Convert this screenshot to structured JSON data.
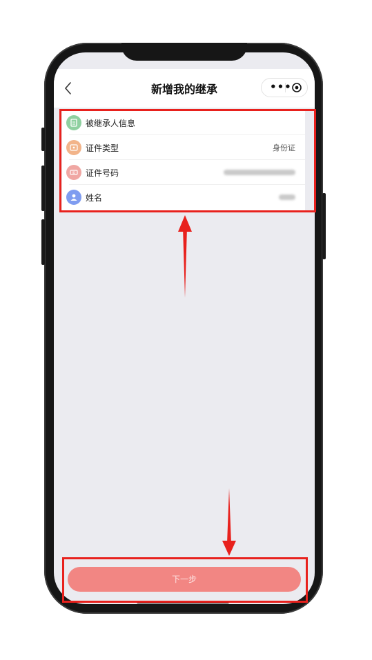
{
  "navbar": {
    "title": "新增我的继承",
    "more_glyph": "•••"
  },
  "form": {
    "rows": [
      {
        "label": "被继承人信息",
        "value": "",
        "icon": "document-icon",
        "icon_color": "#8fd0a0"
      },
      {
        "label": "证件类型",
        "value": "身份证",
        "icon": "card-icon",
        "icon_color": "#f2b48a"
      },
      {
        "label": "证件号码",
        "value": "",
        "icon": "id-number-icon",
        "icon_color": "#f0a7a3"
      },
      {
        "label": "姓名",
        "value": "",
        "icon": "person-icon",
        "icon_color": "#7f9cf0"
      }
    ]
  },
  "footer": {
    "next_label": "下一步"
  },
  "colors": {
    "accent": "#f28683",
    "annotation": "#e8211d"
  }
}
